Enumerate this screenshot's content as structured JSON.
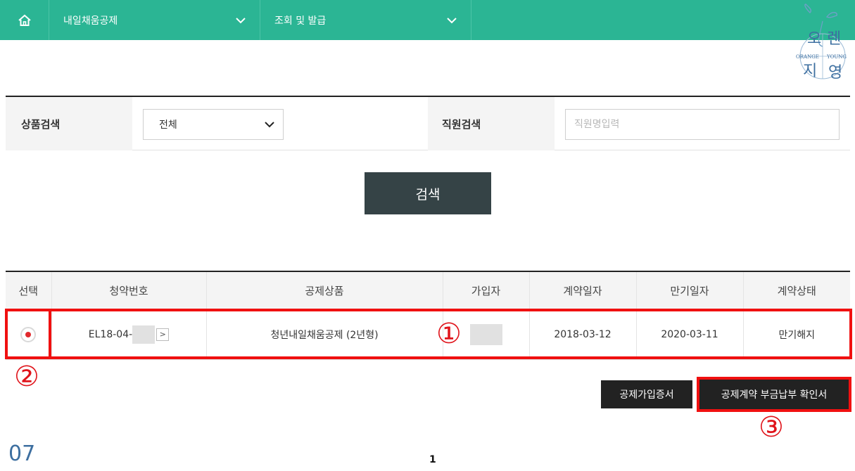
{
  "nav": {
    "home_icon": "home-icon",
    "menu1": "내일채움공제",
    "menu2": "조회 및 발급"
  },
  "logo": {
    "text_left_top": "오",
    "text_right_top": "렌",
    "text_left_bottom": "지",
    "text_right_bottom": "영",
    "arc_left": "ORANGE",
    "arc_right": "YOUNG"
  },
  "search": {
    "product_label": "상품검색",
    "product_value": "전체",
    "staff_label": "직원검색",
    "staff_placeholder": "직원명입력",
    "search_button": "검색"
  },
  "table": {
    "headers": [
      "선택",
      "청약번호",
      "공제상품",
      "가입자",
      "계약일자",
      "만기일자",
      "계약상태"
    ],
    "rows": [
      {
        "contract_prefix": "EL18-04-",
        "product": "청년내일채움공제 (2년형)",
        "join_date": "2018-03-12",
        "maturity_date": "2020-03-11",
        "status": "만기해지"
      }
    ]
  },
  "annotations": {
    "one": "①",
    "two": "②",
    "three": "③"
  },
  "buttons": {
    "certificate": "공제가입증서",
    "confirm": "공제계약 부금납부 확인서"
  },
  "pagination": {
    "current": "1"
  },
  "slide_number": "07",
  "colors": {
    "nav_bg": "#2bb594",
    "button_dark": "#354346",
    "annotation_red": "#f01010"
  }
}
